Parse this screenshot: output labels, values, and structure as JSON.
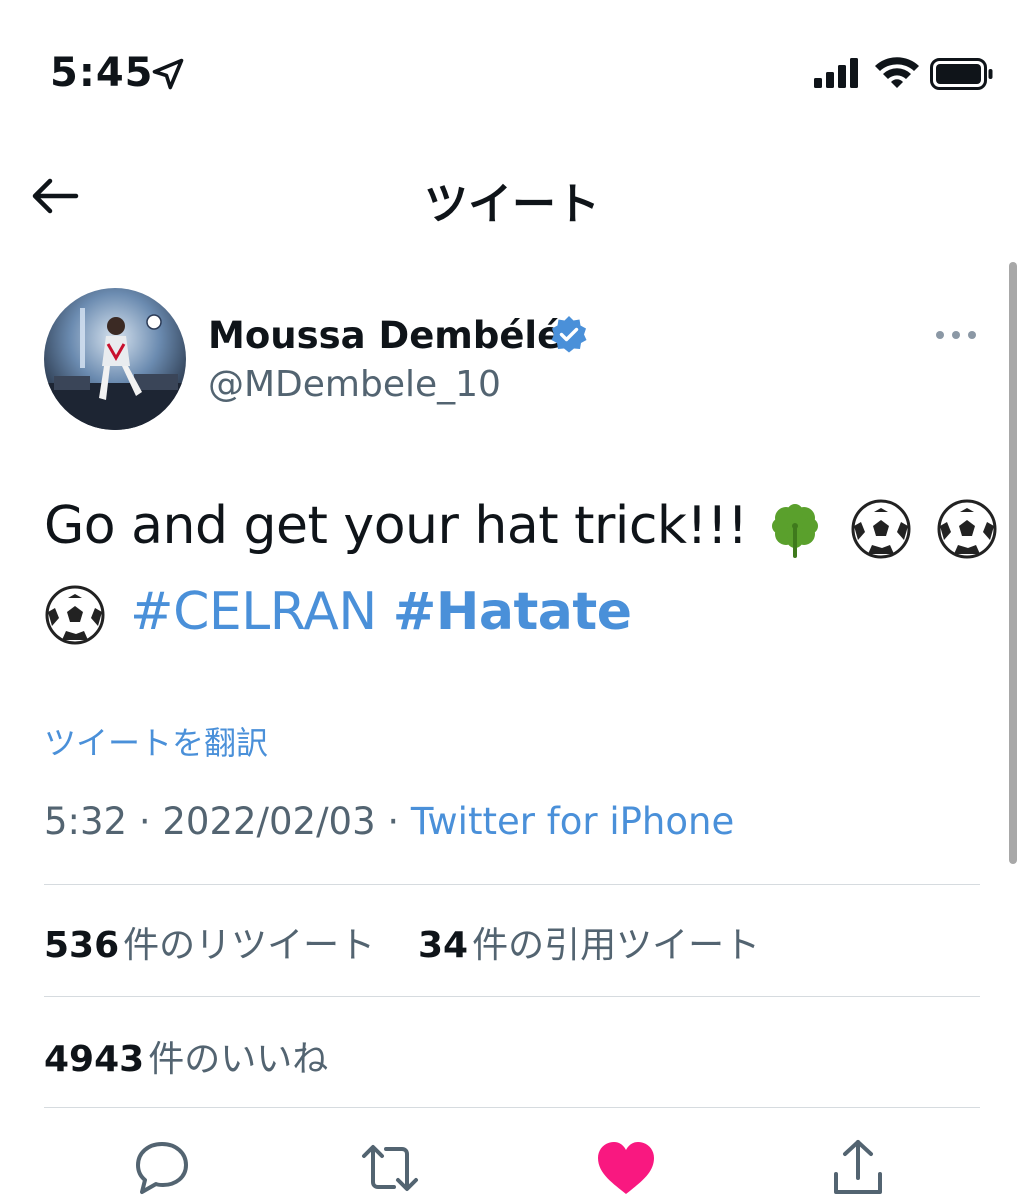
{
  "status_bar": {
    "time": "5:45",
    "icons": [
      "location-arrow-icon",
      "cellular-signal-icon",
      "wifi-icon",
      "battery-icon"
    ]
  },
  "nav": {
    "title": "ツイート",
    "back_icon": "arrow-left-icon"
  },
  "tweet": {
    "author": {
      "display_name": "Moussa Dembélé",
      "handle": "@MDembele_10",
      "verified_icon": "verified-badge-icon"
    },
    "text_line1": "Go and get your hat trick!!!",
    "emojis": [
      "four-leaf-clover",
      "soccer-ball",
      "soccer-ball",
      "soccer-ball"
    ],
    "hashtags": [
      "#CELRAN",
      "#Hatate"
    ],
    "translate_label": "ツイートを翻訳",
    "timestamp": "5:32 · 2022/02/03 · ",
    "source": "Twitter for iPhone"
  },
  "stats": {
    "retweets": {
      "count": "536",
      "label": "件のリツイート"
    },
    "quotes": {
      "count": "34",
      "label": "件の引用ツイート"
    },
    "likes": {
      "count": "4943",
      "label": "件のいいね"
    }
  },
  "actions": {
    "reply_icon": "speech-bubble-icon",
    "retweet_icon": "retweet-arrows-icon",
    "like_icon": "heart-icon",
    "share_icon": "share-upload-icon",
    "like_color": "#f91880",
    "link_color": "#4a90d9",
    "verified_color": "#4a90d9"
  }
}
